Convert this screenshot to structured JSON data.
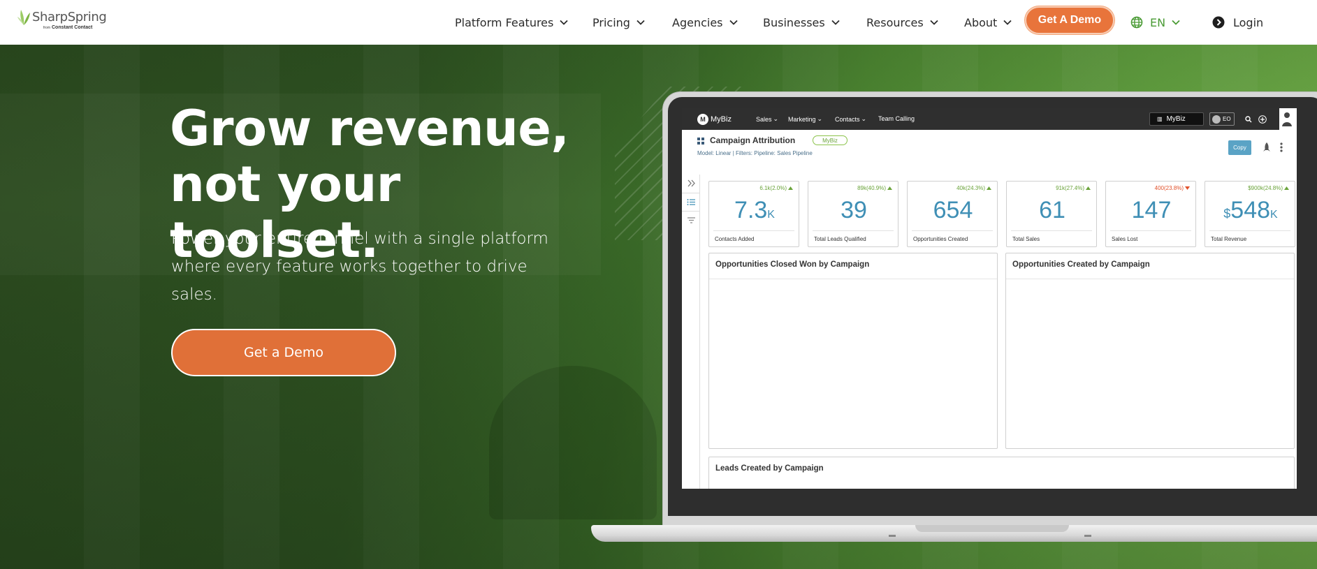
{
  "brand": {
    "name": "SharpSpring",
    "from": "from",
    "sub": "Constant Contact"
  },
  "nav": {
    "items": [
      {
        "label": "Platform Features"
      },
      {
        "label": "Pricing"
      },
      {
        "label": "Agencies"
      },
      {
        "label": "Businesses"
      },
      {
        "label": "Resources"
      },
      {
        "label": "About"
      }
    ],
    "cta": "Get A Demo",
    "language": "EN",
    "login": "Login"
  },
  "hero": {
    "headline_line1": "Grow revenue,",
    "headline_line2": "not your toolset.",
    "subhead": "Power your entire funnel with a single platform where every feature works together to drive sales.",
    "cta": "Get a Demo"
  },
  "app": {
    "logo": "MyBiz",
    "nav": [
      "Sales",
      "Marketing",
      "Contacts",
      "Team Calling"
    ],
    "account": "MyBiz",
    "user_initials": "EO",
    "report_title": "Campaign Attribution",
    "report_badge": "MyBiz",
    "report_meta": "Model: Linear | Filters: Pipeline: Sales Pipeline",
    "copy_label": "Copy",
    "kpis": [
      {
        "prefix": "",
        "value": "7.3",
        "suffix": "K",
        "delta": "6.1k(2.0%)",
        "direction": "up",
        "label": "Contacts Added"
      },
      {
        "prefix": "",
        "value": "39",
        "suffix": "",
        "delta": "89k(40.9%)",
        "direction": "up",
        "label": "Total Leads Qualified"
      },
      {
        "prefix": "",
        "value": "654",
        "suffix": "",
        "delta": "40k(24.3%)",
        "direction": "up",
        "label": "Opportunities Created"
      },
      {
        "prefix": "",
        "value": "61",
        "suffix": "",
        "delta": "91k(27.4%)",
        "direction": "up",
        "label": "Total Sales"
      },
      {
        "prefix": "",
        "value": "147",
        "suffix": "",
        "delta": "400(23.8%)",
        "direction": "down",
        "label": "Sales Lost"
      },
      {
        "prefix": "$",
        "value": "548",
        "suffix": "K",
        "delta": "$900k(24.8%)",
        "direction": "up",
        "label": "Total Revenue"
      }
    ],
    "panels": {
      "closed_won": "Opportunities Closed Won by Campaign",
      "created": "Opportunities Created by Campaign",
      "leads": "Leads Created by Campaign"
    }
  },
  "colors": {
    "accent": "#e8743b",
    "green": "#4a9b35",
    "kpi_blue": "#3f8fb5",
    "delta_up": "#6aa33a",
    "delta_down": "#e1502a"
  },
  "icons": [
    "chevron-down-icon",
    "globe-icon",
    "login-arrow-icon",
    "grid-icon",
    "search-icon",
    "plus-icon",
    "rocket-icon",
    "kebab-icon",
    "expand-icon",
    "list-icon",
    "filter-icon",
    "caret-up-icon",
    "caret-down-icon"
  ]
}
